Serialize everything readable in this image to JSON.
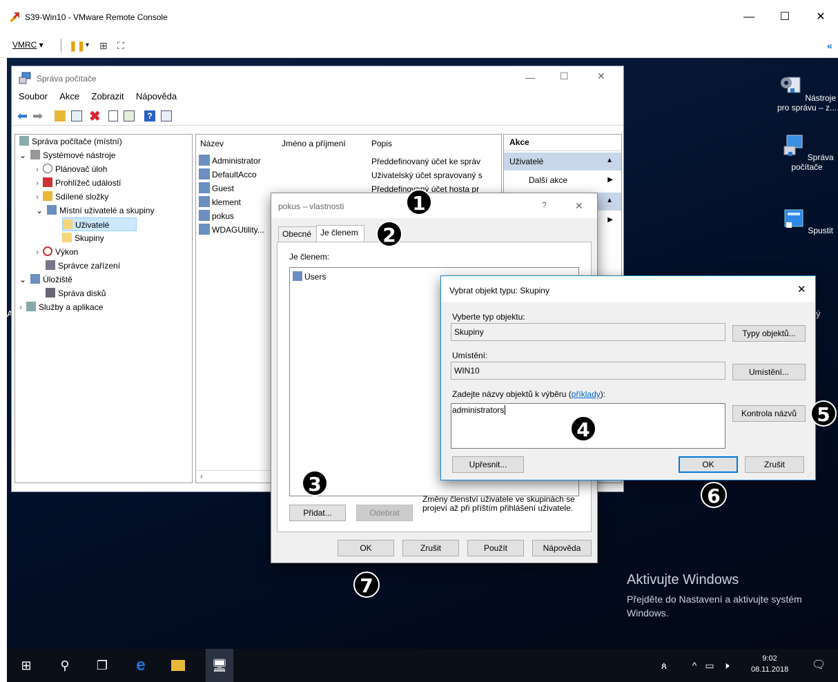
{
  "vmrc": {
    "title": "S39-Win10 - VMware Remote Console",
    "menu_label": "VMRC",
    "minimize": "—",
    "maximize": "☐",
    "close": "✕",
    "expand_icon": "«"
  },
  "desktop": {
    "icons": [
      {
        "label": "Nástroje pro správu – z...",
        "icon": "admin-tools-icon"
      },
      {
        "label": "Správa počítače",
        "icon": "computer-management-icon"
      },
      {
        "label": "Spustit",
        "icon": "run-icon"
      }
    ],
    "activate_title": "Aktivujte Windows",
    "activate_text": "Přejděte do Nastavení a aktivujte systém Windows.",
    "partial_label": "ý",
    "partial_label_left": "A"
  },
  "taskbar": {
    "time": "9:02",
    "date": "08.11.2018"
  },
  "cm": {
    "title": "Správa počítače",
    "menu": [
      "Soubor",
      "Akce",
      "Zobrazit",
      "Nápověda"
    ],
    "tree": [
      {
        "label": "Správa počítače (místní)"
      },
      {
        "label": "Systémové nástroje"
      },
      {
        "label": "Plánovač úloh"
      },
      {
        "label": "Prohlížeč událostí"
      },
      {
        "label": "Sdílené složky"
      },
      {
        "label": "Místní uživatelé a skupiny"
      },
      {
        "label": "Uživatelé"
      },
      {
        "label": "Skupiny"
      },
      {
        "label": "Výkon"
      },
      {
        "label": "Správce zařízení"
      },
      {
        "label": "Úložiště"
      },
      {
        "label": "Správa disků"
      },
      {
        "label": "Služby a aplikace"
      }
    ],
    "columns": [
      "Název",
      "Jméno a příjmení",
      "Popis"
    ],
    "users": [
      {
        "name": "Administrator",
        "desc": "Předdefinovaný účet ke správ"
      },
      {
        "name": "DefaultAcco",
        "desc": "Uživatelský účet spravovaný s"
      },
      {
        "name": "Guest",
        "desc": "Předdefinovaný účet hosta pr"
      },
      {
        "name": "klement",
        "desc": ""
      },
      {
        "name": "pokus",
        "desc": ""
      },
      {
        "name": "WDAGUtility...",
        "desc": ""
      }
    ],
    "actions_header": "Akce",
    "actions_section": "Uživatelé",
    "actions_more": "Další akce"
  },
  "props": {
    "title": "pokus – vlastnosti",
    "help": "?",
    "close": "✕",
    "tabs": [
      "Obecné",
      "Je členem"
    ],
    "member_label": "Je členem:",
    "members": [
      "Users"
    ],
    "add": "Přidat...",
    "remove": "Odebrat",
    "note": "Změny členství uživatele ve skupinách se projeví až při příštím přihlášení uživatele.",
    "ok": "OK",
    "cancel": "Zrušit",
    "apply": "Použít",
    "helpbtn": "Nápověda"
  },
  "select": {
    "title": "Vybrat objekt typu: Skupiny",
    "close": "✕",
    "type_label": "Vyberte typ objektu:",
    "type_value": "Skupiny",
    "type_btn": "Typy objektů...",
    "loc_label": "Umístění:",
    "loc_value": "WIN10",
    "loc_btn": "Umístění...",
    "names_label": "Zadejte názvy objektů k výběru (",
    "names_link": "příklady",
    "names_label_end": "):",
    "names_value": "administrators",
    "check_btn": "Kontrola názvů",
    "advanced": "Upřesnit...",
    "ok": "OK",
    "cancel": "Zrušit"
  },
  "callouts": [
    "1",
    "2",
    "3",
    "4",
    "5",
    "6",
    "7"
  ]
}
